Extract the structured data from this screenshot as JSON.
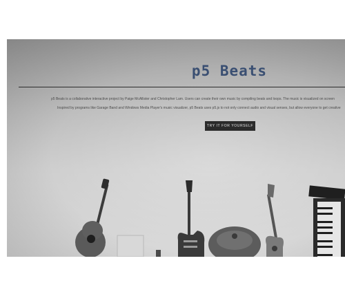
{
  "hero": {
    "title": "p5 Beats",
    "description_line_1": "p5 Beats is a collaborative interactive project by Paige McAllister and Christopher Lam. Users can create their own music by compiling beats and loops. The music is visualized on screen",
    "description_line_2": "Inspired by programs like Garage Band and Windows Media Player's music visualizer, p5 Beats uses p5.js to not only connect audio and visual senses, but allow everyone to get creative",
    "cta_label": "TRY IT FOR YOURSELF"
  },
  "colors": {
    "title": "#3a4f72",
    "button_bg": "#2b2b2b",
    "page_bg": "#ffffff"
  },
  "image_subjects": [
    "acoustic-guitar",
    "amplifier",
    "electric-guitar",
    "cymbal",
    "bass-guitar",
    "keyboard"
  ]
}
